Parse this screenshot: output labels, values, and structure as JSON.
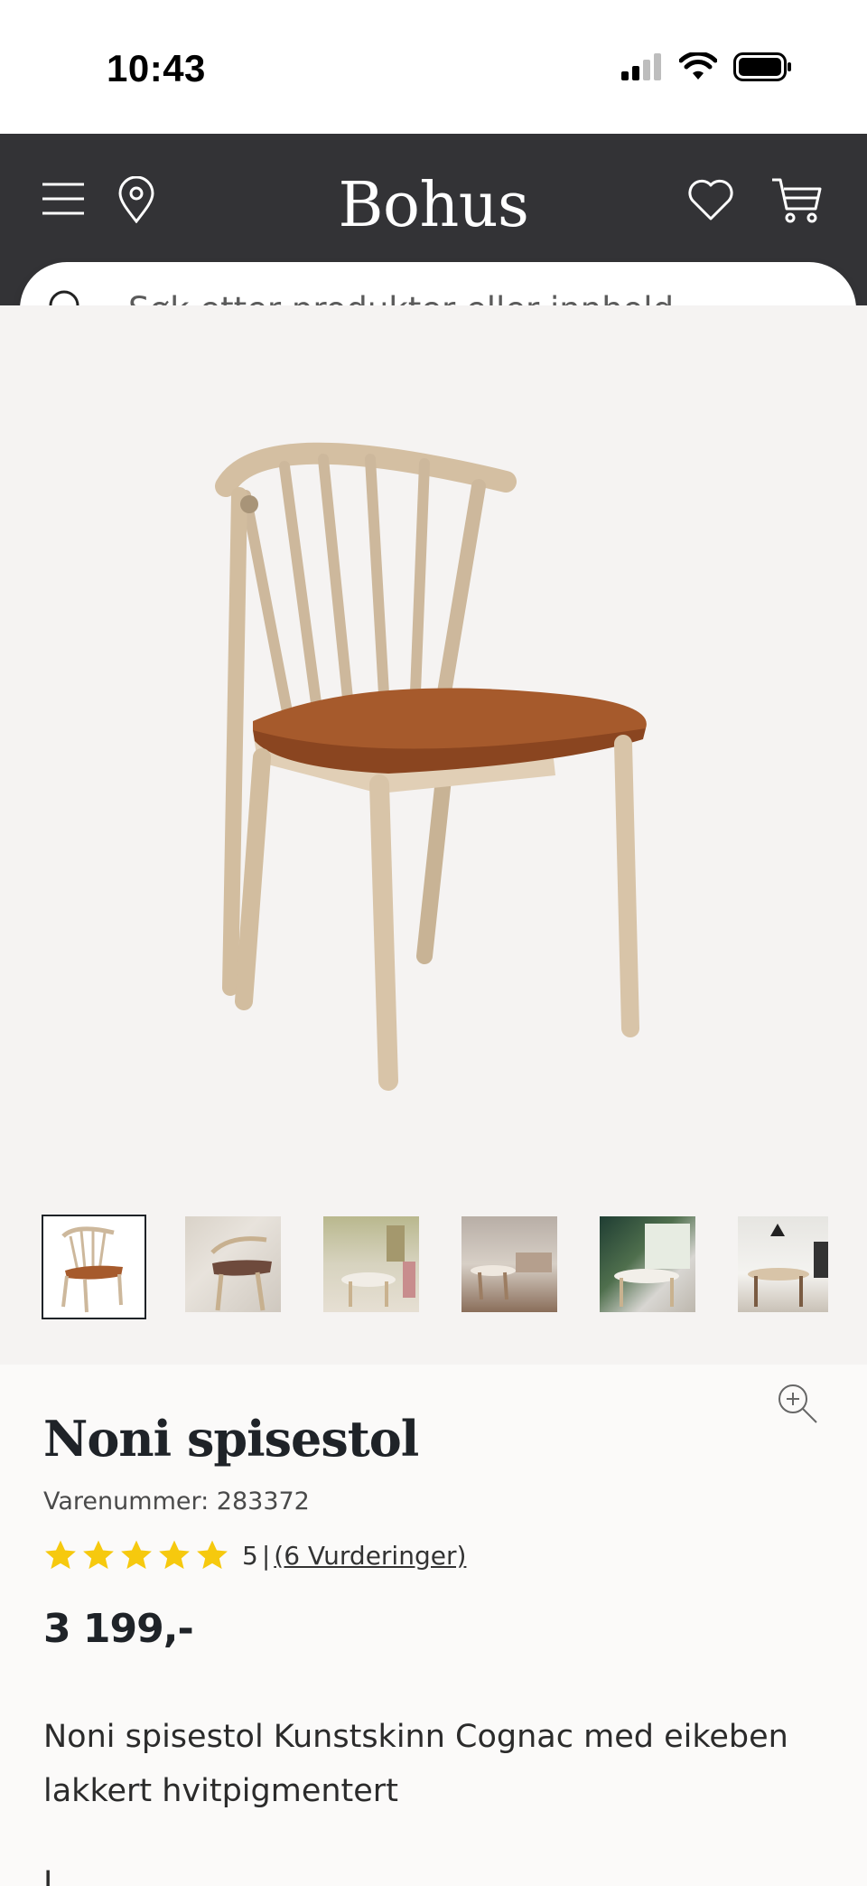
{
  "status_bar": {
    "time": "10:43"
  },
  "header": {
    "logo": "Bohus",
    "icons": [
      "menu-icon",
      "location-pin-icon",
      "heart-icon",
      "cart-icon"
    ]
  },
  "search": {
    "placeholder": "Søk etter produkter eller innhold ..."
  },
  "product": {
    "title": "Noni spisestol",
    "sku": "Varenummer: 283372",
    "rating": {
      "value": "5",
      "separator": "|",
      "reviews_label": "(6 Vurderinger)",
      "stars": 5
    },
    "price": "3 199,-",
    "description": "Noni spisestol Kunstskinn Cognac med eikeben lakkert hvitpigmentert",
    "next_section_partial": "L..."
  },
  "gallery": {
    "thumbnail_count": 6,
    "selected_index": 0
  },
  "colors": {
    "header_bg": "#333336",
    "gallery_bg": "#f5f3f2",
    "star": "#f6c90e",
    "text_dark": "#1f2328"
  }
}
